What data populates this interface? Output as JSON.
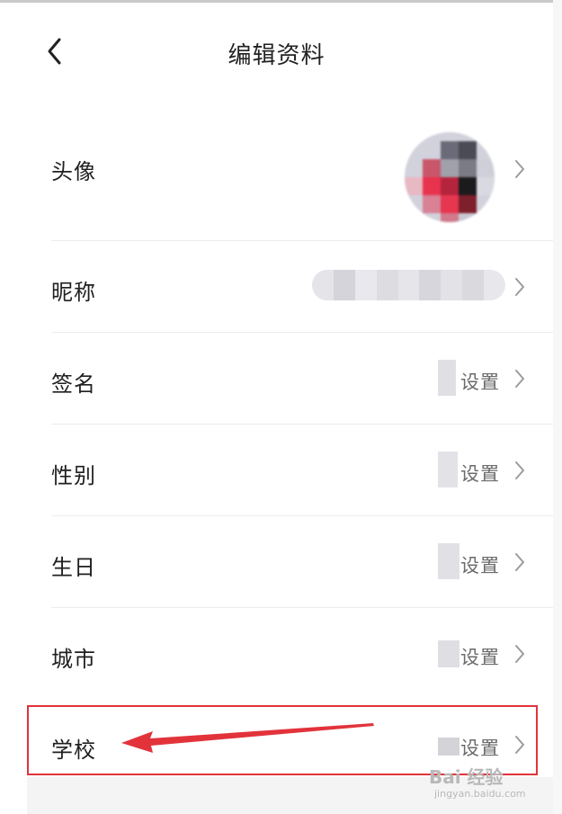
{
  "header": {
    "title": "编辑资料",
    "back_icon": "chevron-left-icon"
  },
  "rows": [
    {
      "label": "头像",
      "value": ""
    },
    {
      "label": "昵称",
      "value": ""
    },
    {
      "label": "签名",
      "value": "设置"
    },
    {
      "label": "性别",
      "value": "设置"
    },
    {
      "label": "生日",
      "value": "设置"
    },
    {
      "label": "城市",
      "value": "设置"
    },
    {
      "label": "学校",
      "value": "设置"
    }
  ],
  "annotation": {
    "color": "#e2333b"
  },
  "watermark": {
    "brand": "Bai 经验",
    "url": "jingyan.baidu.com"
  }
}
